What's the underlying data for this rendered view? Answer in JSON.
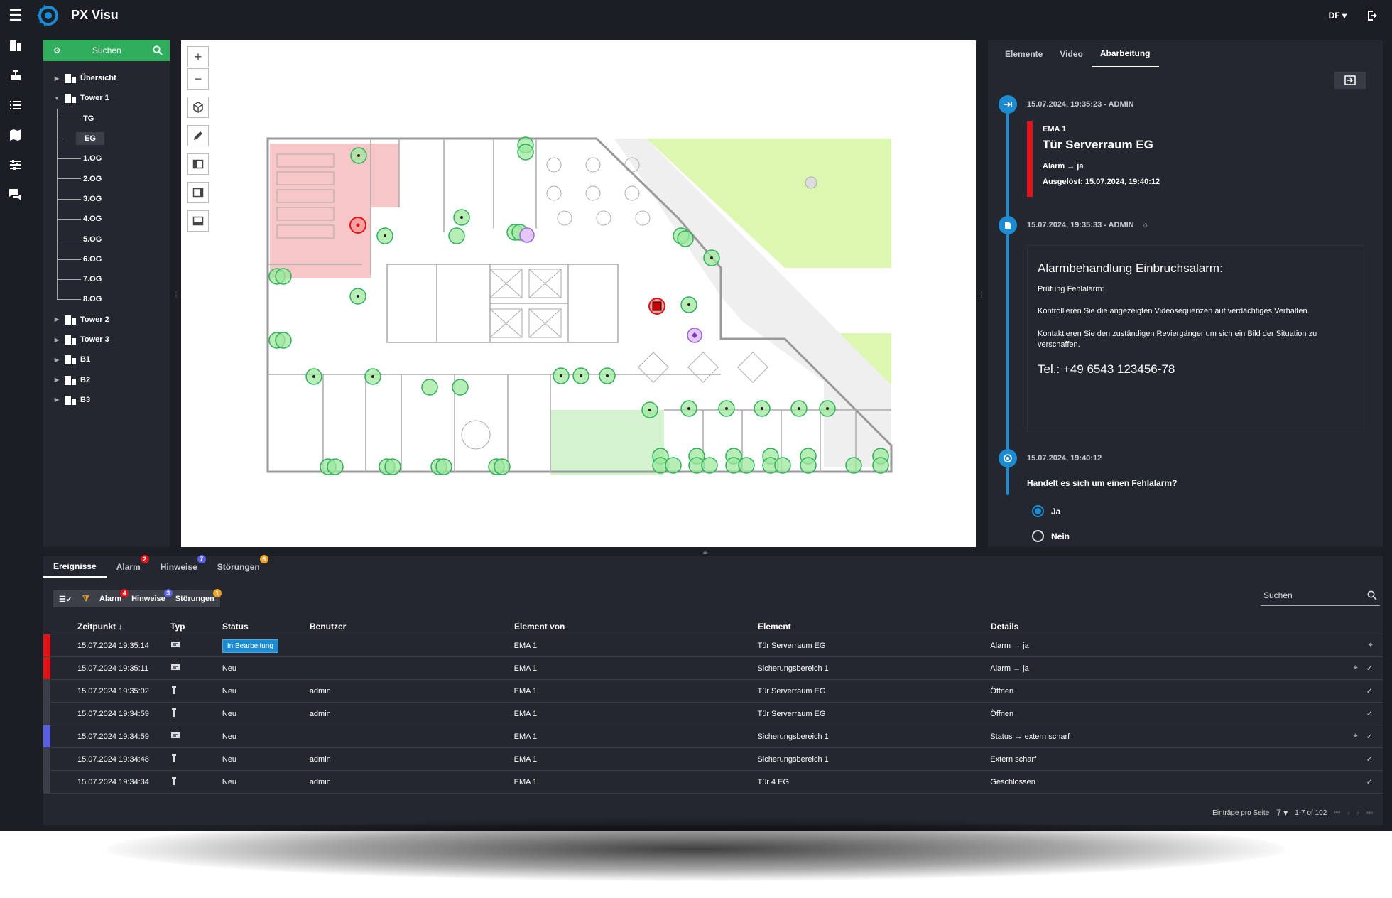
{
  "app": {
    "title": "PX Visu",
    "user": "DF"
  },
  "sidebar": {
    "search_label": "Suchen",
    "tree": [
      {
        "label": "Übersicht",
        "expanded": false
      },
      {
        "label": "Tower 1",
        "expanded": true,
        "children": [
          "TG",
          "EG",
          "1.OG",
          "2.OG",
          "3.OG",
          "4.OG",
          "5.OG",
          "6.OG",
          "7.OG",
          "8.OG"
        ],
        "selected": "EG"
      },
      {
        "label": "Tower 2",
        "expanded": false
      },
      {
        "label": "Tower 3",
        "expanded": false
      },
      {
        "label": "B1",
        "expanded": false
      },
      {
        "label": "B2",
        "expanded": false
      },
      {
        "label": "B3",
        "expanded": false
      }
    ]
  },
  "map_tools": [
    "zoom-in",
    "zoom-out",
    "cube",
    "pencil",
    "panel-left",
    "panel-right",
    "panel-bottom"
  ],
  "right_panel": {
    "tabs": [
      "Elemente",
      "Video",
      "Abarbeitung"
    ],
    "active_tab": "Abarbeitung",
    "entry1": {
      "time": "15.07.2024, 19:35:23 - ADMIN",
      "system": "EMA 1",
      "title": "Tür Serverraum EG",
      "status": "Alarm → ja",
      "triggered": "Ausgelöst: 15.07.2024, 19:40:12"
    },
    "entry2": {
      "time": "15.07.2024, 19:35:33 - ADMIN",
      "heading": "Alarmbehandlung Einbruchsalarm:",
      "p1": "Prüfung Fehlalarm:",
      "p2": "Kontrollieren Sie die angezeigten Videosequenzen auf verdächtiges Verhalten.",
      "p3": "Kontaktieren Sie den zuständigen Reviergänger um sich ein Bild der Situation zu verschaffen.",
      "tel": "Tel.: +49 6543 123456-78"
    },
    "entry3": {
      "time": "15.07.2024, 19:40:12",
      "question": "Handelt es sich um einen Fehlalarm?",
      "options": [
        "Ja",
        "Nein"
      ],
      "selected": "Ja"
    }
  },
  "bottom": {
    "tabs": [
      {
        "label": "Ereignisse",
        "badge": ""
      },
      {
        "label": "Alarm",
        "badge": "2",
        "color": "#e3131a"
      },
      {
        "label": "Hinweise",
        "badge": "7",
        "color": "#5b5fe6"
      },
      {
        "label": "Störungen",
        "badge": "6",
        "color": "#f0a020"
      }
    ],
    "filters": [
      {
        "label": "Alarm",
        "badge": "4",
        "color": "#e3131a"
      },
      {
        "label": "Hinweise",
        "badge": "3",
        "color": "#5b5fe6"
      },
      {
        "label": "Störungen",
        "badge": "1",
        "color": "#f0a020"
      }
    ],
    "search_placeholder": "Suchen",
    "columns": [
      "Zeitpunkt ↓",
      "Typ",
      "Status",
      "Benutzer",
      "Element von",
      "Element",
      "Details"
    ],
    "rows": [
      {
        "time": "15.07.2024 19:35:14",
        "type": "ema",
        "status": "In Bearbeitung",
        "user": "",
        "from": "EMA 1",
        "element": "Tür Serverraum EG",
        "details": "Alarm → ja",
        "strip": "#e3131a",
        "locate": true,
        "check": false
      },
      {
        "time": "15.07.2024 19:35:11",
        "type": "ema",
        "status": "Neu",
        "user": "",
        "from": "EMA 1",
        "element": "Sicherungsbereich 1",
        "details": "Alarm → ja",
        "strip": "#e3131a",
        "locate": true,
        "check": true
      },
      {
        "time": "15.07.2024 19:35:02",
        "type": "user",
        "status": "Neu",
        "user": "admin",
        "from": "EMA 1",
        "element": "Tür Serverraum EG",
        "details": "Öffnen",
        "strip": "#3a3f49",
        "locate": false,
        "check": true
      },
      {
        "time": "15.07.2024 19:34:59",
        "type": "user",
        "status": "Neu",
        "user": "admin",
        "from": "EMA 1",
        "element": "Tür Serverraum EG",
        "details": "Öffnen",
        "strip": "#3a3f49",
        "locate": false,
        "check": true
      },
      {
        "time": "15.07.2024 19:34:59",
        "type": "ema",
        "status": "Neu",
        "user": "",
        "from": "EMA 1",
        "element": "Sicherungsbereich 1",
        "details": "Status → extern scharf",
        "strip": "#5b5fe6",
        "locate": true,
        "check": true
      },
      {
        "time": "15.07.2024 19:34:48",
        "type": "user",
        "status": "Neu",
        "user": "admin",
        "from": "EMA 1",
        "element": "Sicherungsbereich 1",
        "details": "Extern scharf",
        "strip": "#3a3f49",
        "locate": false,
        "check": true
      },
      {
        "time": "15.07.2024 19:34:34",
        "type": "user",
        "status": "Neu",
        "user": "admin",
        "from": "EMA 1",
        "element": "Tür 4 EG",
        "details": "Geschlossen",
        "strip": "#3a3f49",
        "locate": false,
        "check": true
      }
    ],
    "pager": {
      "label": "Einträge pro Seite",
      "per_page": "7",
      "range": "1-7 of 102"
    }
  }
}
